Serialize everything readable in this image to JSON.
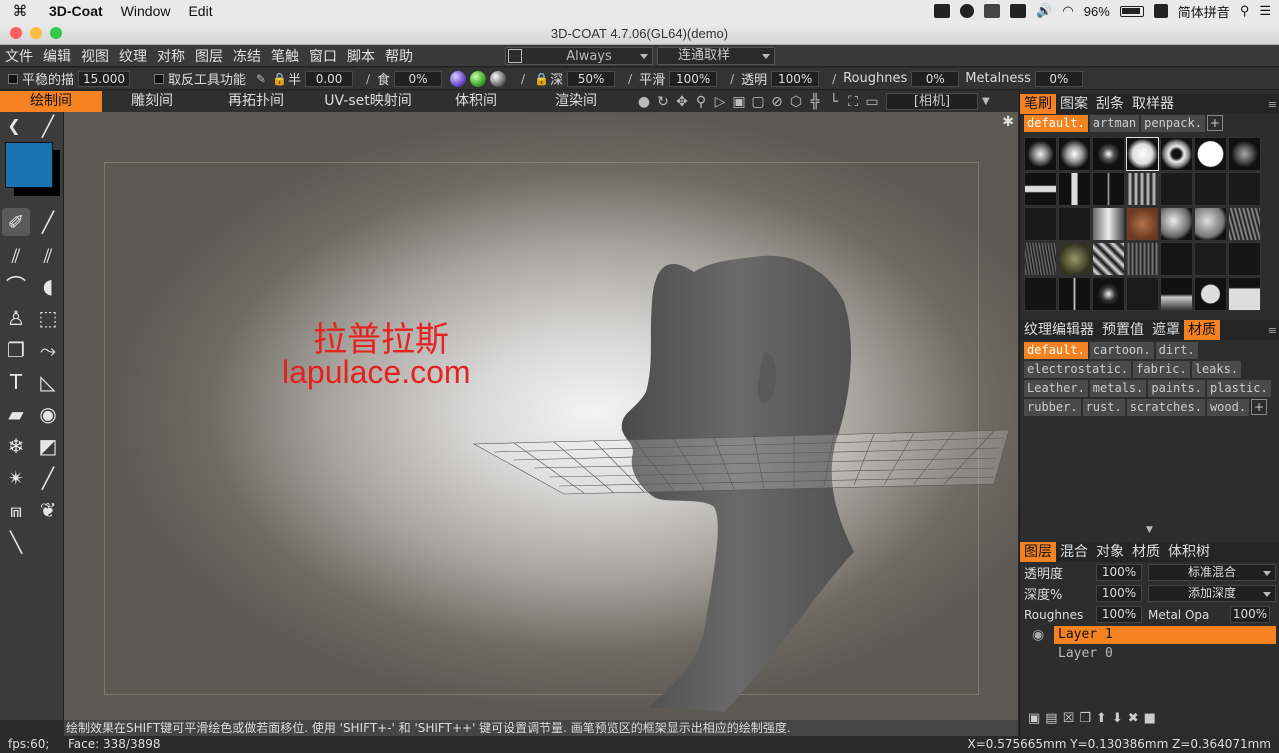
{
  "mac_menubar": {
    "apple": "",
    "app_name": "3D-Coat",
    "menus": [
      "Window",
      "Edit"
    ],
    "battery": "96%",
    "input_method": "简体拼音"
  },
  "window": {
    "title": "3D-COAT 4.7.06(GL64)(demo)"
  },
  "app_menu": {
    "items": [
      "文件",
      "编辑",
      "视图",
      "纹理",
      "对称",
      "图层",
      "冻结",
      "笔触",
      "窗口",
      "脚本",
      "帮助"
    ],
    "always_label": "Always",
    "connect_label": "连通取样"
  },
  "options": {
    "smooth_stroke_label": "平稳的描",
    "smooth_stroke_value": "15.000",
    "invert_tool_label": "取反工具功能",
    "half_label": "半",
    "half_value": "0.00",
    "eat_label": "食",
    "eat_value": "0%",
    "depth_label": "深",
    "depth_value": "50%",
    "smooth_label": "平滑",
    "smooth_value": "100%",
    "opacity_label": "透明",
    "opacity_value": "100%",
    "roughness_label": "Roughnes",
    "roughness_value": "0%",
    "metalness_label": "Metalness",
    "metalness_value": "0%"
  },
  "rooms": {
    "items": [
      "绘制间",
      "雕刻间",
      "再拓扑间",
      "UV-set映射间",
      "体积间",
      "渲染间"
    ],
    "active_index": 0,
    "camera_label": "[相机]"
  },
  "viewport": {
    "watermark_cn": "拉普拉斯",
    "watermark_en": "lapulace.com",
    "hint": "绘制效果在SHIFT键可平滑绘色或做若面移位. 使用 'SHIFT+-' 和 'SHIFT++' 键可设置调节量. 画笔预览区的框架显示出相应的绘制强度."
  },
  "status": {
    "fps": "fps:60;",
    "face": "Face: 338/3898",
    "coords": "X=0.575665mm  Y=0.130386mm  Z=0.364071mm"
  },
  "brush_panel": {
    "tabs": [
      "笔刷",
      "图案",
      "刮条",
      "取样器"
    ],
    "active_tab": 0,
    "presets": [
      "default.",
      "artman",
      "penpack."
    ]
  },
  "material_panel": {
    "tabs": [
      "纹理编辑器",
      "预置值",
      "遮罩",
      "材质"
    ],
    "active_tab": 3,
    "materials": [
      "default.",
      "cartoon.",
      "dirt.",
      "electrostatic.",
      "fabric.",
      "leaks.",
      "Leather.",
      "metals.",
      "paints.",
      "plastic.",
      "rubber.",
      "rust.",
      "scratches.",
      "wood."
    ]
  },
  "layers_panel": {
    "tabs": [
      "图层",
      "混合",
      "对象",
      "材质",
      "体积树"
    ],
    "active_tab": 0,
    "opacity_label": "透明度",
    "opacity_value": "100%",
    "blend_mode": "标准混合",
    "depth_label": "深度%",
    "depth_value": "100%",
    "add_depth": "添加深度",
    "roughness_label": "Roughnes",
    "roughness_value": "100%",
    "metal_label": "Metal Opa",
    "metal_value": "100%",
    "layers": [
      "Layer 1",
      "Layer 0"
    ],
    "active_layer": 0
  },
  "colors": {
    "accent": "#f58220",
    "primary_color": "#1a72b0",
    "secondary_color": "#000000",
    "watermark": "#e82020"
  }
}
